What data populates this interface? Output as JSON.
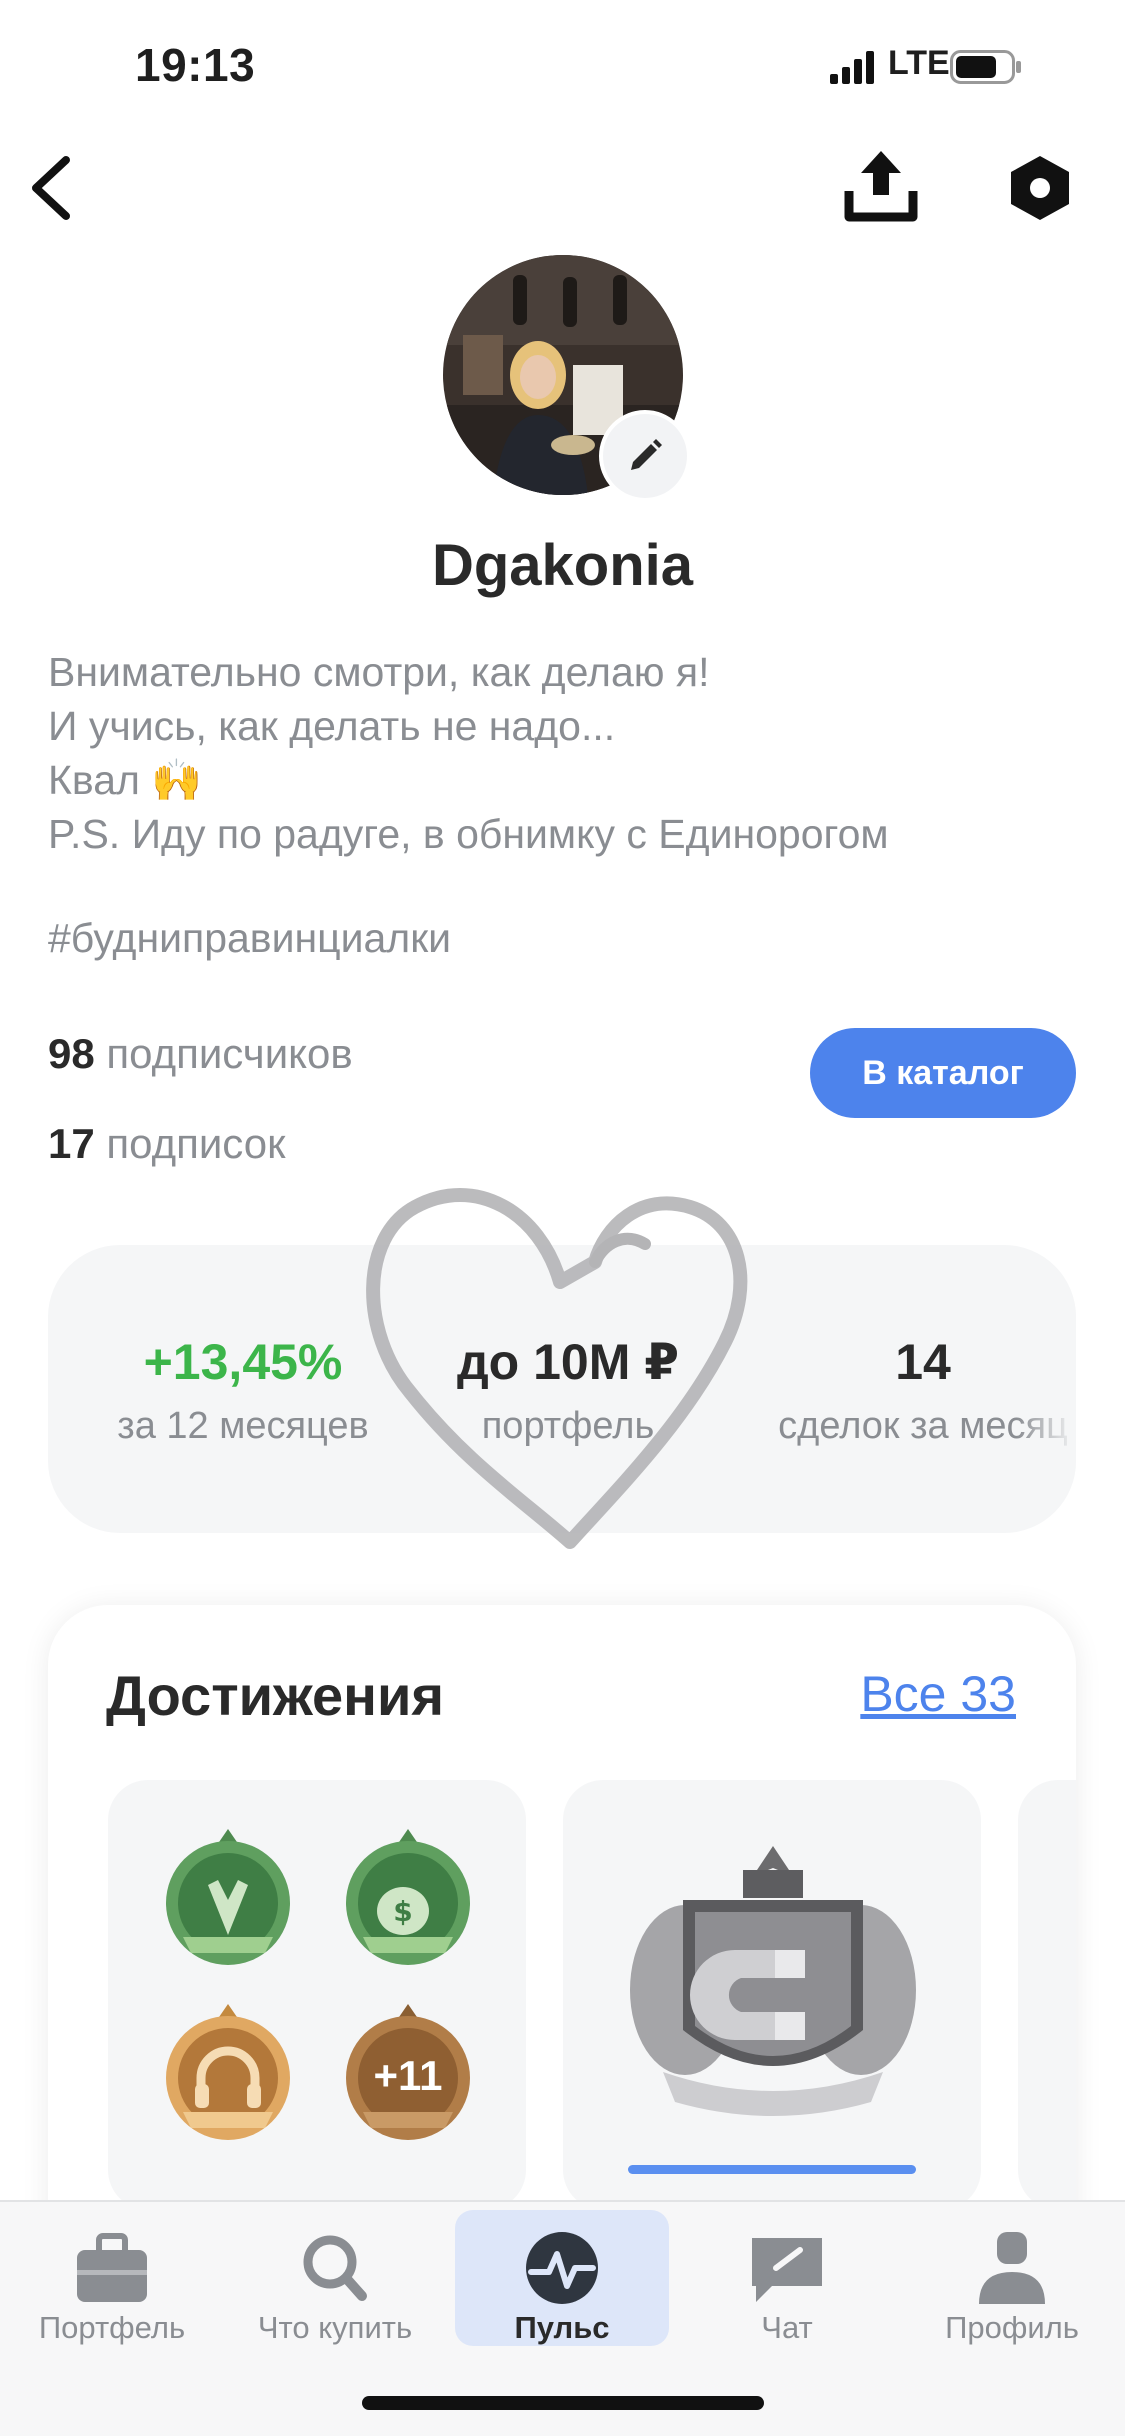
{
  "status_bar": {
    "time": "19:13",
    "network": "LTE",
    "battery_level": 0.75
  },
  "nav": {
    "back_icon": "chevron-left-icon",
    "share_icon": "share-upload-icon",
    "settings_icon": "hexagon-settings-icon"
  },
  "profile": {
    "username": "Dgakonia",
    "bio_lines": [
      "Внимательно смотри, как делаю я!",
      "И учись, как делать не надо...",
      "Квал 🙌",
      "P.S. Иду по радуге, в обнимку с Единорогом"
    ],
    "hashtag": "#будниправинциалки",
    "followers_count": "98",
    "followers_label": "подписчиков",
    "following_count": "17",
    "following_label": "подписок",
    "catalog_button": "В каталог"
  },
  "stats": [
    {
      "value": "+13,45%",
      "label": "за 12 месяцев"
    },
    {
      "value": "до 10M ₽",
      "label": "портфель"
    },
    {
      "value": "14",
      "label": "сделок за месяц"
    }
  ],
  "achievements": {
    "title": "Достижения",
    "all_link": "Все 33",
    "extra_badge": "+11",
    "progress": 1.0
  },
  "tabs": [
    {
      "label": "Портфель",
      "icon": "briefcase-icon"
    },
    {
      "label": "Что купить",
      "icon": "search-icon"
    },
    {
      "label": "Пульс",
      "icon": "pulse-icon",
      "active": true
    },
    {
      "label": "Чат",
      "icon": "chat-icon"
    },
    {
      "label": "Профиль",
      "icon": "profile-icon"
    }
  ],
  "colors": {
    "accent": "#4d83ec",
    "positive": "#3cb54a",
    "muted_text": "#8a8d92"
  }
}
